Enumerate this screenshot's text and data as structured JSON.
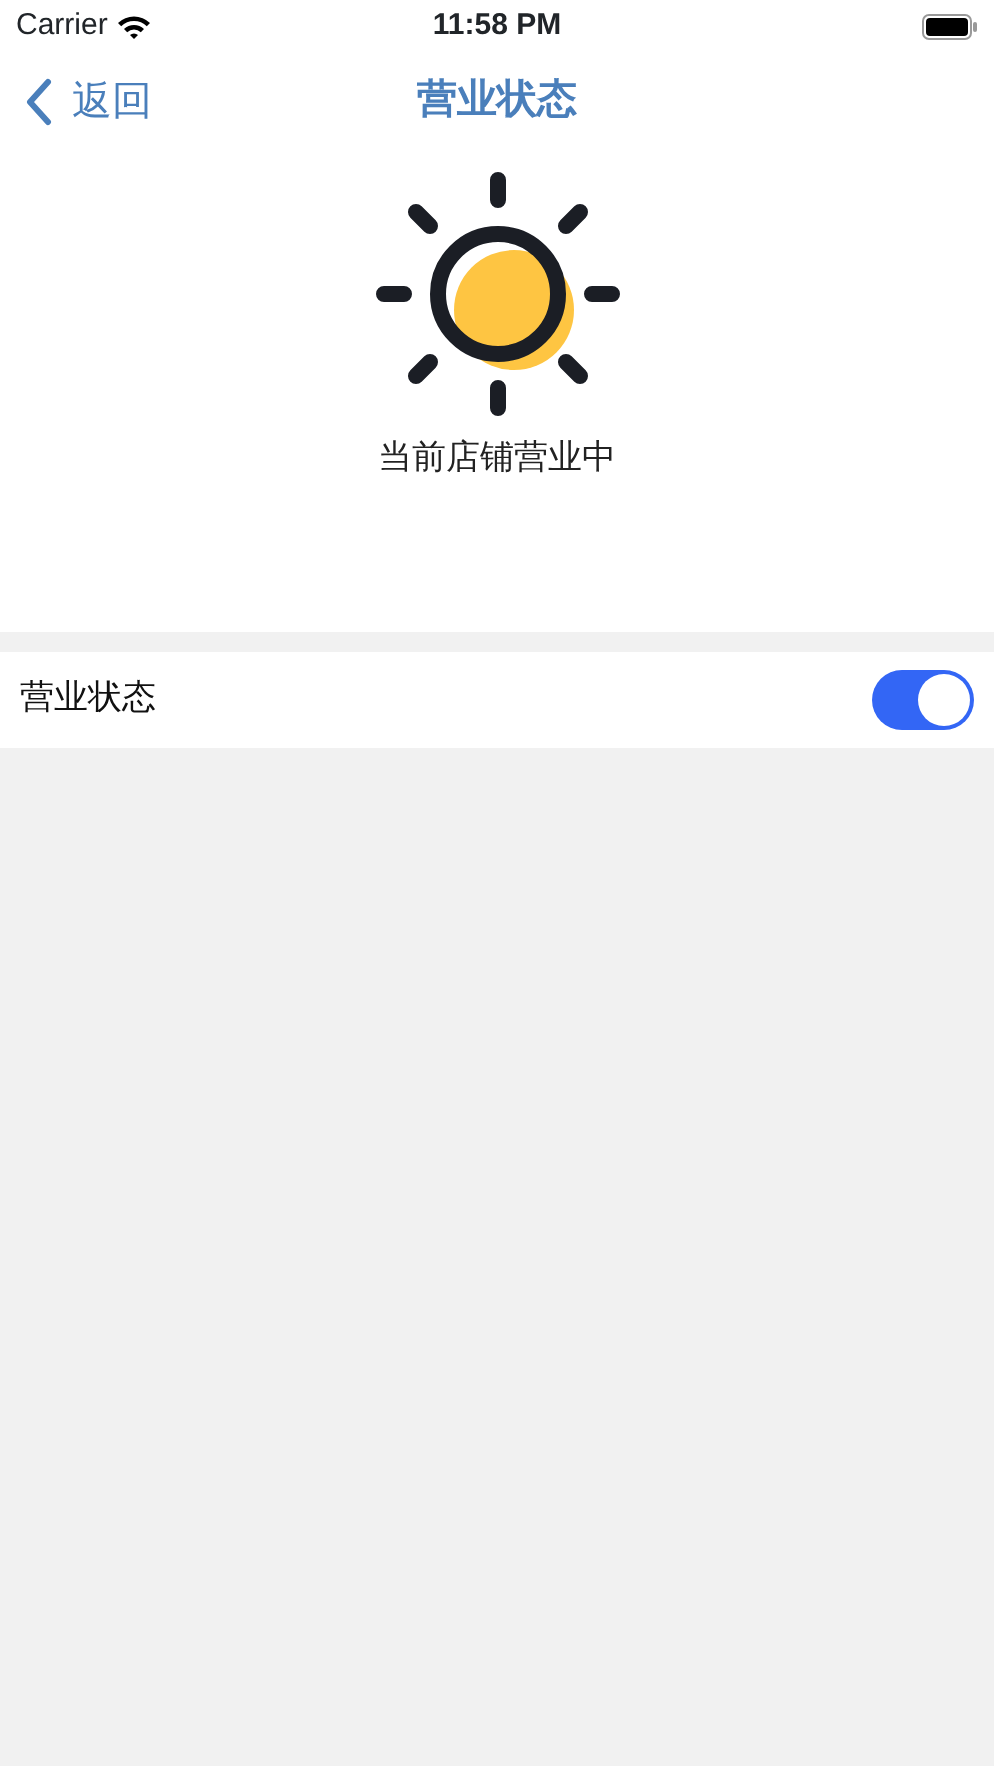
{
  "status_bar": {
    "carrier": "Carrier",
    "time": "11:58 PM"
  },
  "nav": {
    "back": "返回",
    "title": "营业状态"
  },
  "hero": {
    "caption": "当前店铺营业中"
  },
  "settings": [
    {
      "label": "营业状态",
      "kind": "toggle",
      "on": true
    }
  ]
}
